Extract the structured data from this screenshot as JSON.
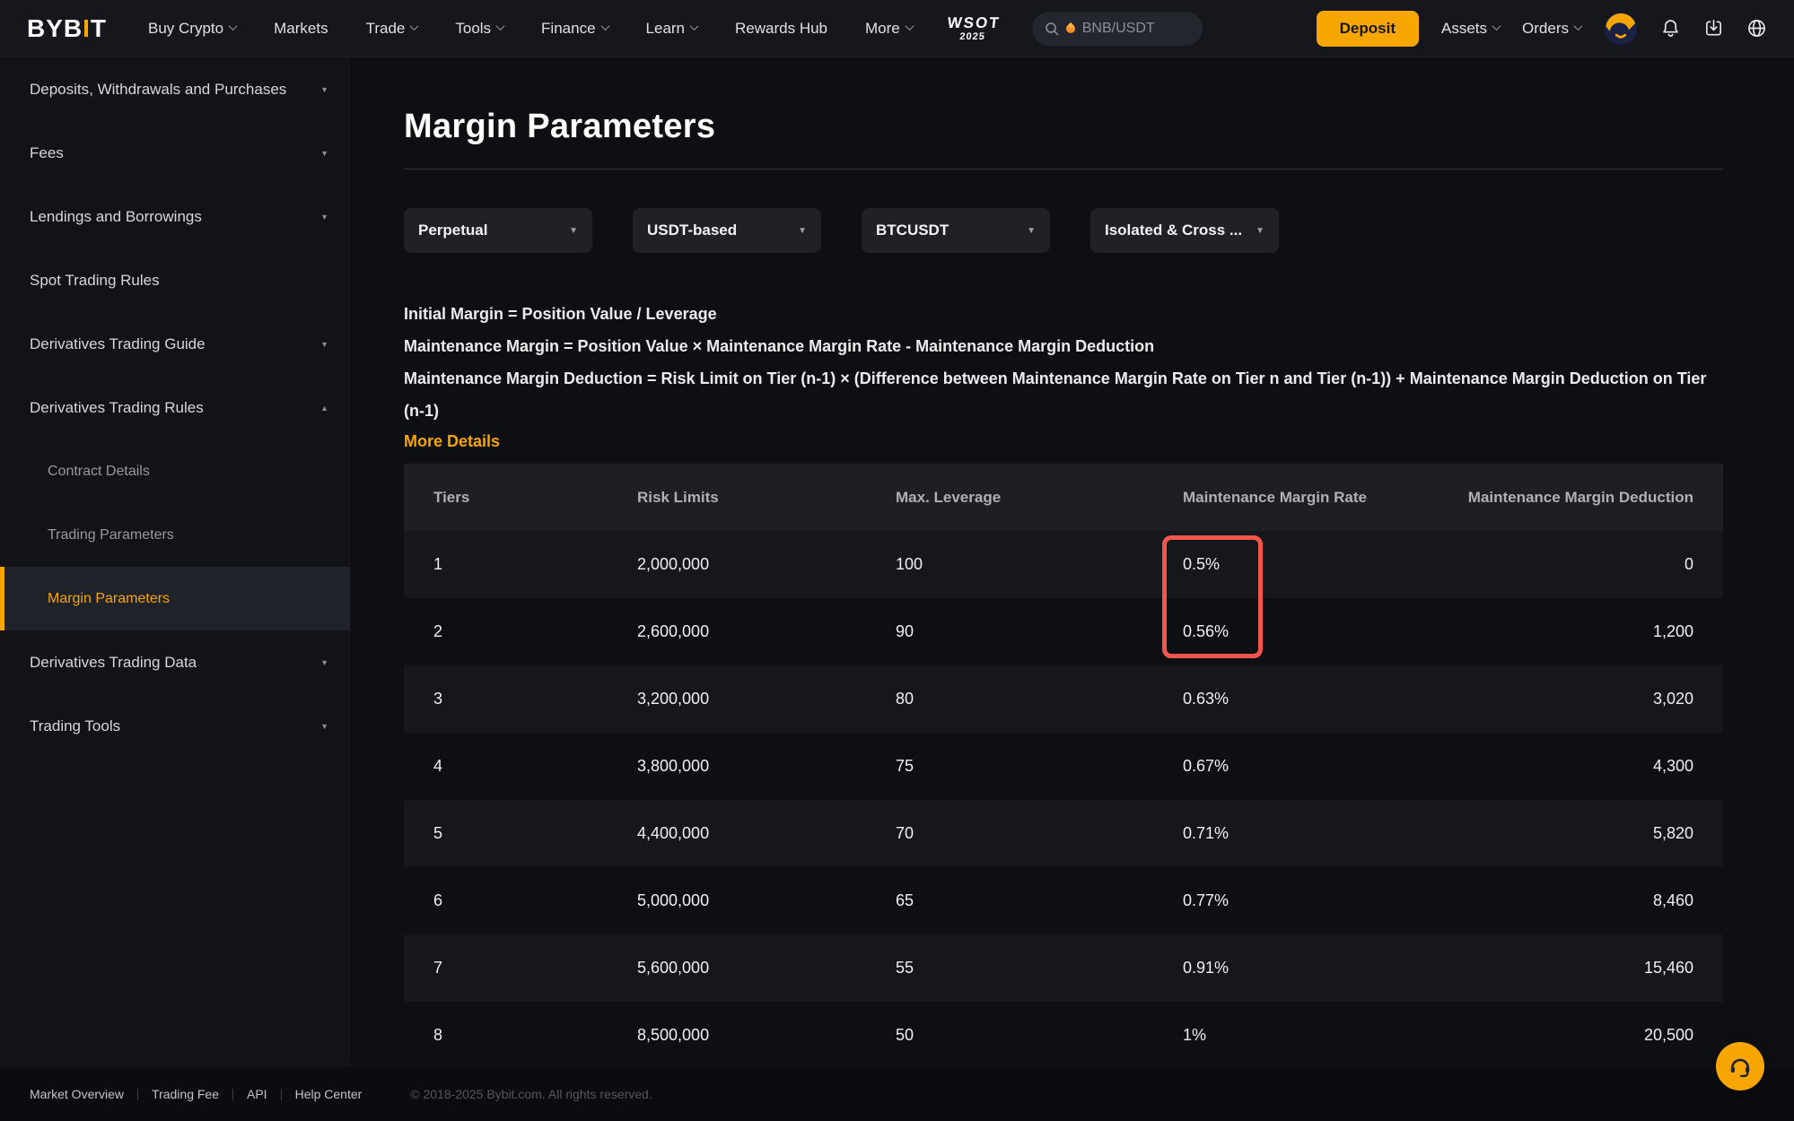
{
  "topbar": {
    "logo": {
      "part1": "BYB",
      "accent": "I",
      "part2": "T"
    },
    "nav": [
      {
        "label": "Buy Crypto",
        "chevron": true
      },
      {
        "label": "Markets",
        "chevron": false
      },
      {
        "label": "Trade",
        "chevron": true
      },
      {
        "label": "Tools",
        "chevron": true
      },
      {
        "label": "Finance",
        "chevron": true
      },
      {
        "label": "Learn",
        "chevron": true
      },
      {
        "label": "Rewards Hub",
        "chevron": false
      },
      {
        "label": "More",
        "chevron": true
      }
    ],
    "wsot": {
      "line1": "WSOT",
      "line2": "2025"
    },
    "search": {
      "placeholder": "BNB/USDT"
    },
    "deposit_label": "Deposit",
    "account_nav": [
      {
        "label": "Assets",
        "chevron": true
      },
      {
        "label": "Orders",
        "chevron": true
      }
    ]
  },
  "sidebar": {
    "items": [
      {
        "label": "Deposits, Withdrawals and Purchases",
        "chevron": "down"
      },
      {
        "label": "Fees",
        "chevron": "down"
      },
      {
        "label": "Lendings and Borrowings",
        "chevron": "down"
      },
      {
        "label": "Spot Trading Rules",
        "chevron": "none"
      },
      {
        "label": "Derivatives Trading Guide",
        "chevron": "down"
      },
      {
        "label": "Derivatives Trading Rules",
        "chevron": "up"
      },
      {
        "label": "Contract Details",
        "sub": true,
        "chevron": "none"
      },
      {
        "label": "Trading Parameters",
        "sub": true,
        "chevron": "none"
      },
      {
        "label": "Margin Parameters",
        "sub": true,
        "chevron": "none",
        "active": true
      },
      {
        "label": "Derivatives Trading Data",
        "chevron": "down"
      },
      {
        "label": "Trading Tools",
        "chevron": "down"
      }
    ]
  },
  "main": {
    "title": "Margin Parameters",
    "filters": [
      {
        "value": "Perpetual"
      },
      {
        "value": "USDT-based"
      },
      {
        "value": "BTCUSDT"
      },
      {
        "value": "Isolated & Cross ..."
      }
    ],
    "formulas": [
      "Initial Margin = Position Value / Leverage",
      "Maintenance Margin = Position Value × Maintenance Margin Rate - Maintenance Margin Deduction",
      "Maintenance Margin Deduction = Risk Limit on Tier (n-1) × (Difference between Maintenance Margin Rate on Tier n and Tier (n-1)) + Maintenance Margin Deduction on Tier (n-1)"
    ],
    "more_details_label": "More Details"
  },
  "table": {
    "headers": [
      "Tiers",
      "Risk Limits",
      "Max. Leverage",
      "Maintenance Margin Rate",
      "Maintenance Margin Deduction"
    ],
    "rows": [
      [
        "1",
        "2,000,000",
        "100",
        "0.5%",
        "0"
      ],
      [
        "2",
        "2,600,000",
        "90",
        "0.56%",
        "1,200"
      ],
      [
        "3",
        "3,200,000",
        "80",
        "0.63%",
        "3,020"
      ],
      [
        "4",
        "3,800,000",
        "75",
        "0.67%",
        "4,300"
      ],
      [
        "5",
        "4,400,000",
        "70",
        "0.71%",
        "5,820"
      ],
      [
        "6",
        "5,000,000",
        "65",
        "0.77%",
        "8,460"
      ],
      [
        "7",
        "5,600,000",
        "55",
        "0.91%",
        "15,460"
      ],
      [
        "8",
        "8,500,000",
        "50",
        "1%",
        "20,500"
      ]
    ]
  },
  "footer": {
    "links": [
      "Market Overview",
      "Trading Fee",
      "API",
      "Help Center"
    ],
    "copyright": "© 2018-2025 Bybit.com. All rights reserved."
  },
  "colors": {
    "accent": "#f7a600",
    "highlight_box": "#f4554d"
  }
}
